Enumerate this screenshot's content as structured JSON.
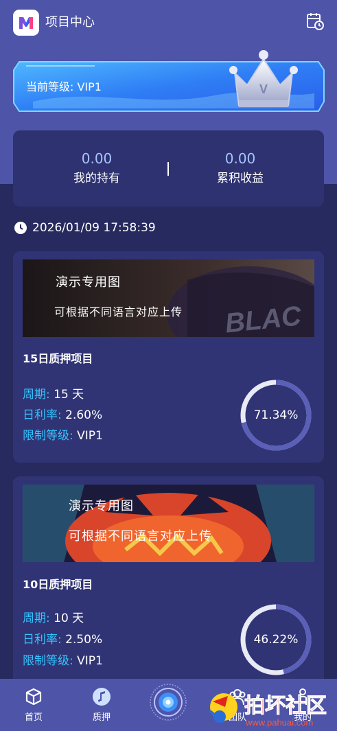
{
  "header": {
    "title": "项目中心",
    "logo_icon": "app-logo-icon",
    "history_icon": "calendar-clock-icon"
  },
  "level": {
    "label": "当前等级: VIP1",
    "badge_letter": "V"
  },
  "stats": [
    {
      "value": "0.00",
      "label": "我的持有"
    },
    {
      "value": "0.00",
      "label": "累积收益"
    }
  ],
  "datetime": "2026/01/09 17:58:39",
  "projects": [
    {
      "image_title": "演示专用图",
      "image_subtitle": "可根据不同语言对应上传",
      "image_bg_text": "BLAC",
      "name": "15日质押项目",
      "period_label": "周期:",
      "period_value": "15 天",
      "rate_label": "日利率:",
      "rate_value": "2.60%",
      "level_label": "限制等级:",
      "level_value": "VIP1",
      "progress_text": "71.34%",
      "progress": 0.7134
    },
    {
      "image_title": "演示专用图",
      "image_subtitle": "可根据不同语言对应上传",
      "name": "10日质押项目",
      "period_label": "周期:",
      "period_value": "10 天",
      "rate_label": "日利率:",
      "rate_value": "2.50%",
      "level_label": "限制等级:",
      "level_value": "VIP1",
      "progress_text": "46.22%",
      "progress": 0.4622
    }
  ],
  "tabs": [
    {
      "label": "首页",
      "icon": "cube-icon"
    },
    {
      "label": "质押",
      "icon": "music-note-icon"
    },
    {
      "label": "",
      "icon": "center-circle-icon"
    },
    {
      "label": "团队",
      "icon": "team-icon"
    },
    {
      "label": "我的",
      "icon": "person-icon"
    }
  ],
  "watermark": {
    "text": "拍坏社区",
    "url": "www.pahuai.com"
  },
  "colors": {
    "header_bg": "#4e54a8",
    "page_bg": "#272a5e",
    "card_bg": "#303474",
    "stats_card_bg": "#2f3270",
    "accent_cyan": "#35c5ff",
    "stat_value": "#a7c4ff",
    "ring_track": "#e8eaf5",
    "ring_fill": "#5a5fb8"
  }
}
